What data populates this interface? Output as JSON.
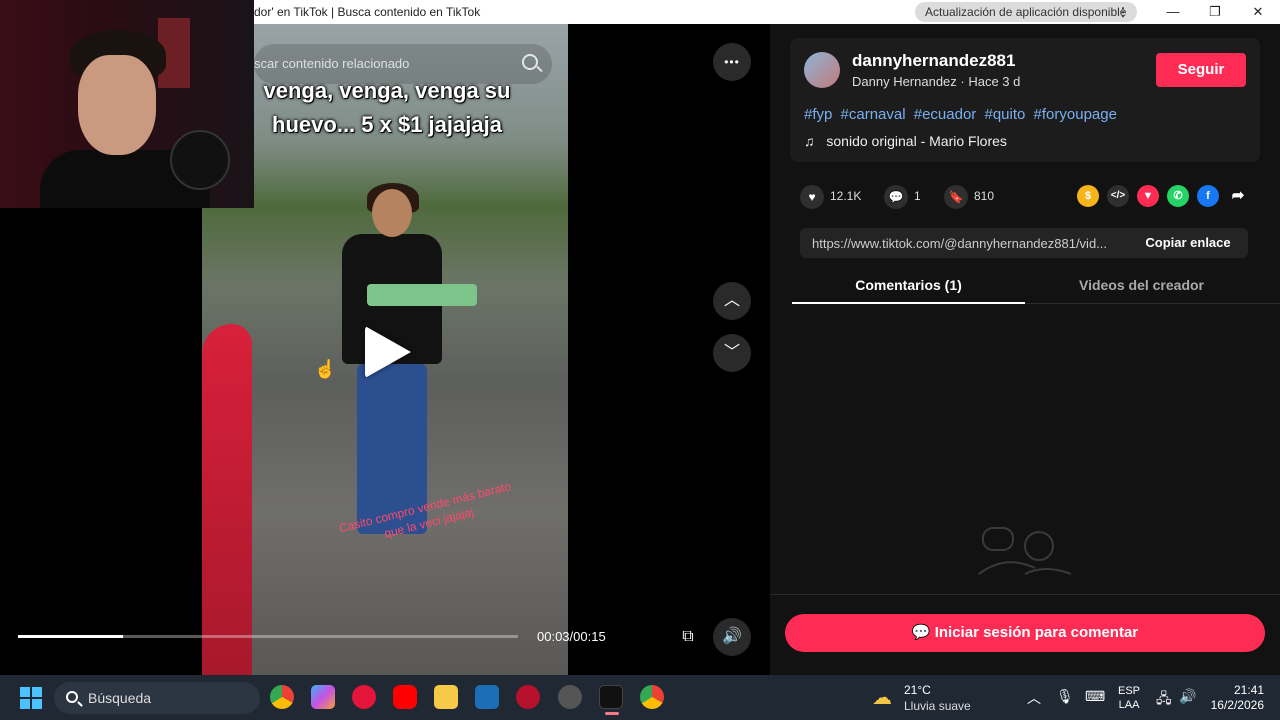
{
  "window": {
    "title": "dor' en TikTok | Busca contenido en TikTok",
    "update_notice": "Actualización de aplicación disponible",
    "controls": {
      "minimize": "—",
      "restore": "❐",
      "close": "✕"
    }
  },
  "video": {
    "search_placeholder": "scar contenido relacionado",
    "caption_top": "venga, venga, venga su huevo... 5 x $1 jajajaja",
    "caption_overlay": "Casito compro vende más barato que la veci jajajaj",
    "time": "00:03/00:15",
    "progress_fraction": 0.21,
    "more_label": "•••",
    "up_label": "︿",
    "down_label": "﹀"
  },
  "author": {
    "username": "dannyhernandez881",
    "subline": "Danny Hernandez · Hace 3 d",
    "follow_label": "Seguir",
    "hashtags": [
      "#fyp",
      "#carnaval",
      "#ecuador",
      "#quito",
      "#foryoupage"
    ],
    "music_note": "♫",
    "music": "sonido original - Mario Flores"
  },
  "stats": {
    "likes": "12.1K",
    "comments": "1",
    "saves": "810"
  },
  "share": {
    "link": "https://www.tiktok.com/@dannyhernandez881/vid...",
    "copy_label": "Copiar enlace",
    "icons": [
      "coin-icon",
      "embed-icon",
      "send-icon",
      "whatsapp-icon",
      "facebook-icon",
      "share-arrow-icon"
    ]
  },
  "tabs": [
    {
      "label": "Comentarios (1)",
      "active": true
    },
    {
      "label": "Videos del creador",
      "active": false
    }
  ],
  "login_label": "Iniciar sesión para comentar",
  "taskbar": {
    "search": "Búsqueda",
    "weather_temp": "21°C",
    "weather_desc": "Lluvia suave",
    "lang_top": "ESP",
    "lang_bottom": "LAA",
    "time": "21:41",
    "date": "16/2/2026"
  },
  "colors": {
    "accent": "#fe2c55",
    "hashtag": "#7aaff0",
    "panel": "#121212"
  }
}
